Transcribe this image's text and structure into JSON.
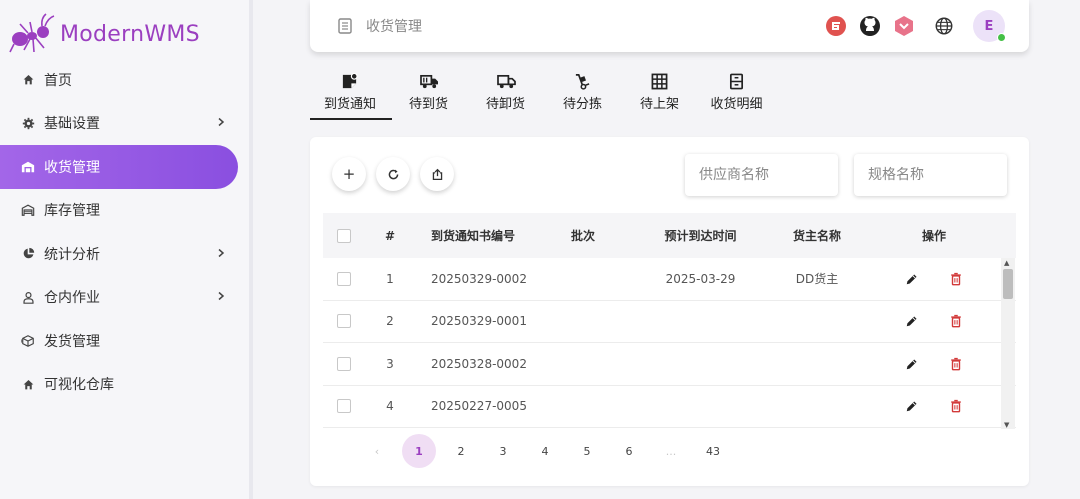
{
  "brand": {
    "name": "ModernWMS",
    "color": "#9b3fc0"
  },
  "sidebar": {
    "items": [
      {
        "label": "首页",
        "icon": "home-icon",
        "chevron": false,
        "active": false
      },
      {
        "label": "基础设置",
        "icon": "gear-icon",
        "chevron": true,
        "active": false
      },
      {
        "label": "收货管理",
        "icon": "warehouse-in-icon",
        "chevron": false,
        "active": true
      },
      {
        "label": "库存管理",
        "icon": "warehouse-icon",
        "chevron": false,
        "active": false
      },
      {
        "label": "统计分析",
        "icon": "pie-chart-icon",
        "chevron": true,
        "active": false
      },
      {
        "label": "仓内作业",
        "icon": "worker-icon",
        "chevron": true,
        "active": false
      },
      {
        "label": "发货管理",
        "icon": "shipping-icon",
        "chevron": false,
        "active": false
      },
      {
        "label": "可视化仓库",
        "icon": "home-icon",
        "chevron": false,
        "active": false
      }
    ]
  },
  "header": {
    "title": "收货管理",
    "avatar_letter": "E",
    "icons": [
      "gitee-icon",
      "github-icon",
      "brand-icon",
      "globe-icon"
    ]
  },
  "tabs": [
    {
      "label": "到货通知",
      "icon": "note-icon",
      "active": true
    },
    {
      "label": "待到货",
      "icon": "truck-icon",
      "active": false
    },
    {
      "label": "待卸货",
      "icon": "truck-unload-icon",
      "active": false
    },
    {
      "label": "待分拣",
      "icon": "hand-truck-icon",
      "active": false
    },
    {
      "label": "待上架",
      "icon": "grid-icon",
      "active": false
    },
    {
      "label": "收货明细",
      "icon": "cabinet-icon",
      "active": false
    }
  ],
  "toolbar": {
    "add": "+",
    "refresh": "⟳",
    "export": "⇪",
    "supplier_placeholder": "供应商名称",
    "spec_placeholder": "规格名称"
  },
  "table": {
    "headers": [
      "#",
      "到货通知书编号",
      "批次",
      "预计到达时间",
      "货主名称",
      "操作"
    ],
    "rows": [
      {
        "index": "1",
        "code": "20250329-0002",
        "batch": "",
        "eta": "2025-03-29",
        "owner": "DD货主"
      },
      {
        "index": "2",
        "code": "20250329-0001",
        "batch": "",
        "eta": "",
        "owner": ""
      },
      {
        "index": "3",
        "code": "20250328-0002",
        "batch": "",
        "eta": "",
        "owner": ""
      },
      {
        "index": "4",
        "code": "20250227-0005",
        "batch": "",
        "eta": "",
        "owner": ""
      }
    ]
  },
  "pagination": {
    "prev": "‹",
    "pages": [
      "1",
      "2",
      "3",
      "4",
      "5",
      "6"
    ],
    "ellipsis": "...",
    "last": "43",
    "current": "1"
  }
}
